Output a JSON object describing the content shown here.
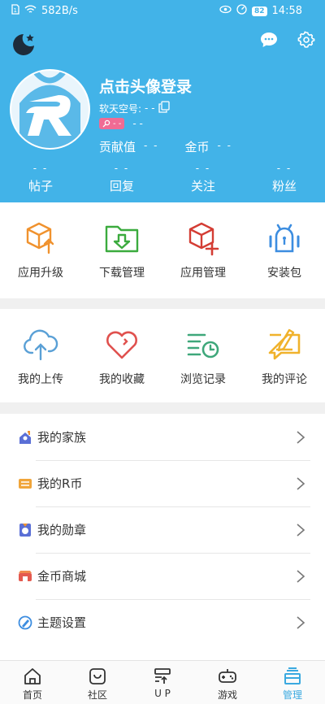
{
  "status": {
    "speed": "582B/s",
    "battery": "82",
    "time": "14:58"
  },
  "profile": {
    "login_title": "点击头像登录",
    "soft_id_label": "软天空号:",
    "soft_id_value": "- -",
    "badge_value": "- -",
    "badge_extra": "- -",
    "contribution_label": "贡献值",
    "contribution_value": "- -",
    "coin_label": "金币",
    "coin_value": "- -"
  },
  "counts": [
    {
      "label": "帖子",
      "value": "- -"
    },
    {
      "label": "回复",
      "value": "- -"
    },
    {
      "label": "关注",
      "value": "- -"
    },
    {
      "label": "粉丝",
      "value": "- -"
    }
  ],
  "tools": [
    {
      "label": "应用升级",
      "icon": "upgrade-box-icon",
      "color": "#f0922e"
    },
    {
      "label": "下载管理",
      "icon": "download-folder-icon",
      "color": "#3bab3e"
    },
    {
      "label": "应用管理",
      "icon": "app-manage-box-icon",
      "color": "#d43d34"
    },
    {
      "label": "安装包",
      "icon": "android-icon",
      "color": "#3c8de0"
    }
  ],
  "personal": [
    {
      "label": "我的上传",
      "icon": "cloud-upload-icon",
      "color": "#5aa0d6"
    },
    {
      "label": "我的收藏",
      "icon": "heart-icon",
      "color": "#e0514e"
    },
    {
      "label": "浏览记录",
      "icon": "history-list-icon",
      "color": "#3ea77a"
    },
    {
      "label": "我的评论",
      "icon": "comment-edit-icon",
      "color": "#f0b22c"
    }
  ],
  "menu": [
    {
      "label": "我的家族",
      "icon": "family-icon"
    },
    {
      "label": "我的R币",
      "icon": "r-coin-icon"
    },
    {
      "label": "我的勋章",
      "icon": "medal-icon"
    },
    {
      "label": "金币商城",
      "icon": "shop-icon"
    },
    {
      "label": "主题设置",
      "icon": "theme-palette-icon"
    }
  ],
  "nav": [
    {
      "label": "首页",
      "icon": "home-icon"
    },
    {
      "label": "社区",
      "icon": "community-icon"
    },
    {
      "label": "U P",
      "icon": "up-icon"
    },
    {
      "label": "游戏",
      "icon": "gamepad-icon"
    },
    {
      "label": "管理",
      "icon": "manage-icon",
      "active": true
    }
  ],
  "colors": {
    "accent": "#42b3e8",
    "pink": "#f06b94",
    "active_nav": "#3aa9e0"
  }
}
